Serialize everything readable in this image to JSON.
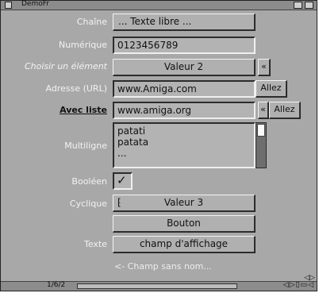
{
  "window": {
    "title": "DemoFr"
  },
  "labels": {
    "chaine": "Chaîne",
    "numerique": "Numérique",
    "choisir": "Choisir un élément",
    "adresse": "Adresse (URL)",
    "avec_liste": "Avec liste",
    "multiligne": "Multiligne",
    "booleen": "Booléen",
    "cyclique": "Cyclique",
    "texte": "Texte"
  },
  "fields": {
    "chaine": "... Texte libre ...",
    "numerique": "0123456789",
    "choisir": "Valeur 2",
    "adresse": "www.Amiga.com",
    "avec_liste": "www.amiga.org",
    "multiligne": [
      "patati",
      "patata",
      "..."
    ],
    "booleen": "✓",
    "cyclique": "Valeur 3",
    "texte": "champ d'affichage"
  },
  "buttons": {
    "popup_symbol": "«",
    "allez": "Allez",
    "bouton": "Bouton",
    "cycle_symbol": "⁅"
  },
  "unnamed": "<- Champ sans nom...",
  "status": {
    "position": "1/6/2"
  },
  "icons": {
    "close": "close-icon",
    "depth": "depth-icon",
    "arrows": "arrows-icon"
  }
}
